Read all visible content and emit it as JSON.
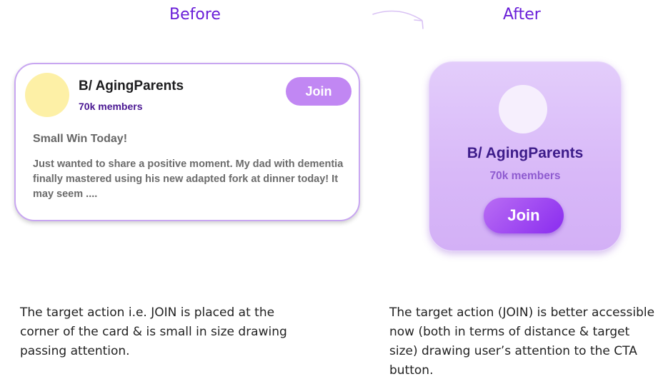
{
  "headings": {
    "before": "Before",
    "after": "After"
  },
  "colors": {
    "accent": "#6a1fd8",
    "join_before": "#c187f3",
    "join_after": "#8a2cef",
    "avatar_before": "#fdf0a6",
    "card_border": "#c8a6f1"
  },
  "before_card": {
    "group": "B/ AgingParents",
    "members": "70k members",
    "join_label": "Join",
    "post_title": "Small Win Today!",
    "post_body": "Just wanted to share a positive moment. My dad with dementia finally mastered using his new adapted fork at dinner today! It may seem ...."
  },
  "after_card": {
    "group": "B/ AgingParents",
    "members": "70k members",
    "join_label": "Join"
  },
  "captions": {
    "before": "The target action i.e. JOIN is placed at the corner of the card & is small in size drawing passing attention.",
    "after": "The target action (JOIN) is better accessible now (both in terms of distance & target size) drawing user’s attention to the CTA button."
  },
  "icons": [
    "curved-arrow-icon"
  ]
}
